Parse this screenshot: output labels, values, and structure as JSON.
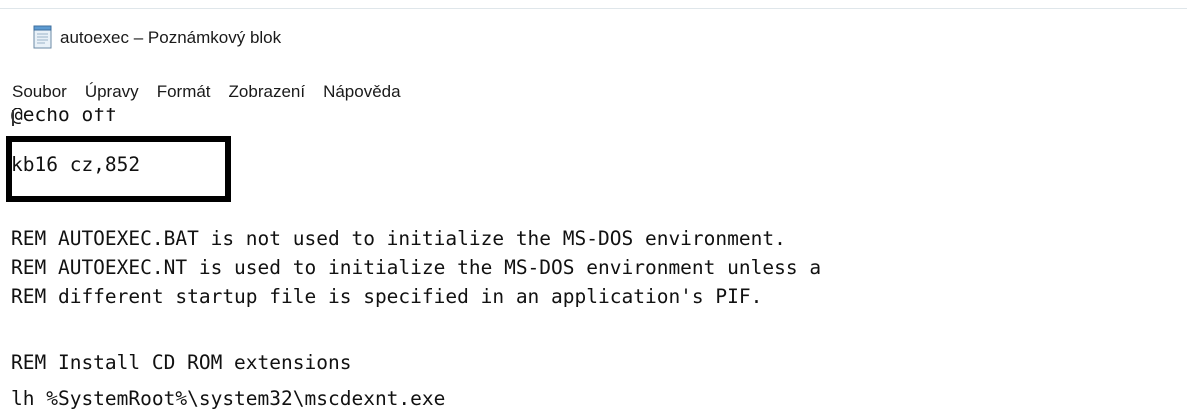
{
  "window": {
    "title": "autoexec – Poznámkový blok",
    "icon": "notepad-icon"
  },
  "menu": {
    "items": [
      {
        "label": "Soubor"
      },
      {
        "label": "Úpravy"
      },
      {
        "label": "Formát"
      },
      {
        "label": "Zobrazení"
      },
      {
        "label": "Nápověda"
      }
    ]
  },
  "editor": {
    "lines": [
      "@echo off",
      "kb16 cz,852",
      "",
      "REM AUTOEXEC.BAT is not used to initialize the MS-DOS environment.",
      "REM AUTOEXEC.NT is used to initialize the MS-DOS environment unless a",
      "REM different startup file is specified in an application's PIF.",
      "",
      "REM Install CD ROM extensions",
      "lh %SystemRoot%\\system32\\mscdexnt.exe"
    ]
  }
}
